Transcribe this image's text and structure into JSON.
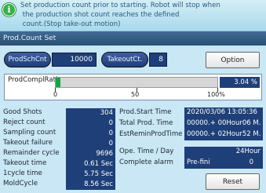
{
  "info": {
    "icon": "info-icon",
    "text": "Set production count prior to starting. Robot will stop when\n the production shot count reaches the defined\n count.(Stop take-out motion)"
  },
  "section_title": "Prod.Count Set",
  "count_row": {
    "prod_sch_btn": "ProdSchCnt",
    "prod_sch_value": "10000",
    "takeout_btn": "TakeoutCt.",
    "takeout_value": "8",
    "option_btn": "Option"
  },
  "ratio": {
    "label": "ProdComplRatio",
    "value_text": "3.04 %",
    "fraction": 0.0304,
    "ticks": [
      "0",
      "50",
      "100%"
    ],
    "bar_color": "#19a24a"
  },
  "stats_left": [
    {
      "label": "Good Shots",
      "value": "304"
    },
    {
      "label": "Reject count",
      "value": "0"
    },
    {
      "label": "Sampling count",
      "value": "0"
    },
    {
      "label": "Takeout failure",
      "value": "0"
    },
    {
      "label": "Remainder cycle",
      "value": "9696"
    },
    {
      "label": "Takeout time",
      "value": "0.61 Sec"
    },
    {
      "label": "1cycle time",
      "value": "5.75 Sec"
    },
    {
      "label": "MoldCycle",
      "value": "8.56 Sec"
    }
  ],
  "stats_right": {
    "prod_start_label": "Prod.Start Time",
    "prod_start_value": "2020/03/06 13:05:36",
    "total_prod_label": "Total Prod. Time",
    "total_prod_value": "00000.+ 00Hour06 M.",
    "est_remain_label": "EstReminProdTime",
    "est_remain_value": "00000.+ 02Hour52 M.",
    "ope_time_label": "Ope. Time / Day",
    "ope_time_value": "24Hour",
    "complete_alarm_label": "Complete alarm",
    "complete_alarm_mode": "Pre-fini",
    "complete_alarm_value": "0"
  },
  "reset_btn": "Reset",
  "colors": {
    "accent": "#1e3f78",
    "header": "#2a4f73",
    "background": "#c9e7f5"
  }
}
